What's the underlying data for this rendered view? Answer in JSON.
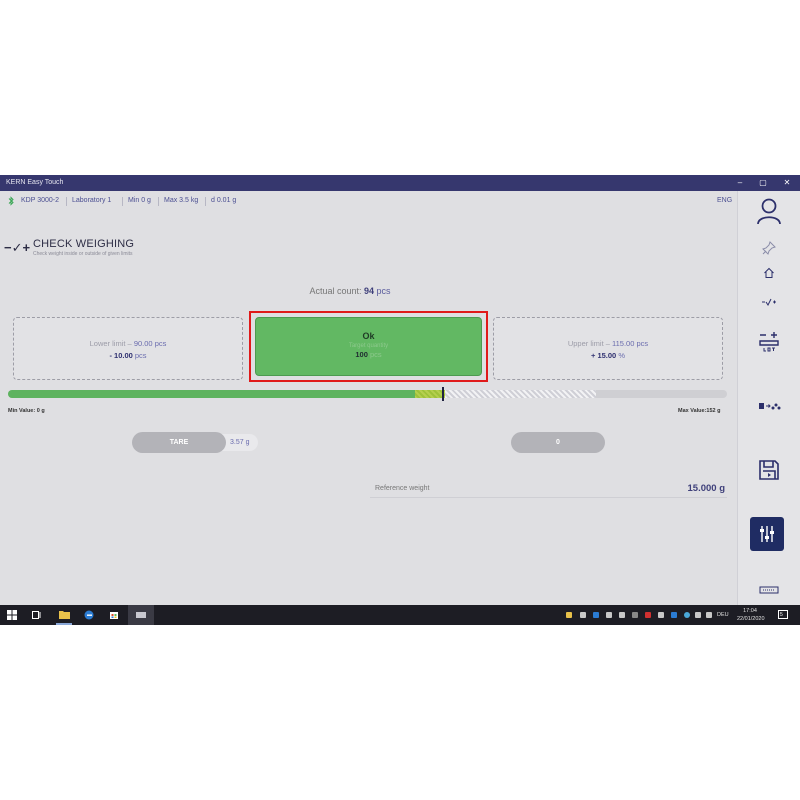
{
  "window": {
    "title": "KERN Easy Touch",
    "minimize": "–",
    "maximize": "▢",
    "close": "✕"
  },
  "infobar": {
    "device": "KDP 3000-2",
    "location": "Laboratory 1",
    "min": "Min 0 g",
    "max": "Max 3.5 kg",
    "resolution": "d 0.01 g",
    "language": "ENG"
  },
  "header": {
    "icon_text": "−✓+",
    "title": "CHECK WEIGHING",
    "subtitle": "Check weight inside or outside of given limits"
  },
  "actual": {
    "label": "Actual count:",
    "value": "94",
    "unit": "pcs"
  },
  "lower": {
    "label": "Lower limit – ",
    "value": "90.00",
    "unit": "pcs",
    "tol_value": "- 10.00",
    "tol_unit": "pcs"
  },
  "result": {
    "status": "Ok",
    "target_label": "Target quantity",
    "target_value": "100",
    "target_unit": "pcs"
  },
  "upper": {
    "label": "Upper limit – ",
    "value": "115.00",
    "unit": "pcs",
    "tol_value": "+ 15.00",
    "tol_unit": "%"
  },
  "bar": {
    "min_label": "Min Value: 0 g",
    "max_label": "Max Value:152 g",
    "fill_fraction": 0.566,
    "tolerance_end_fraction": 0.608,
    "upper_end_fraction": 0.818,
    "marker_fraction": 0.603
  },
  "buttons": {
    "tare_label": "TARE",
    "tare_value": "3.57",
    "tare_unit": "g",
    "zero_label": "0"
  },
  "reference": {
    "label": "Reference weight",
    "value": "15.000 g"
  },
  "taskbar": {
    "clock_time": "17:04",
    "clock_date": "22/01/2020",
    "lang": "DEU",
    "notification_count": "5"
  },
  "colors": {
    "accent": "#36376e",
    "ok_green": "#62b863",
    "highlight_red": "#e01a1a",
    "active_nav": "#1f2c63"
  }
}
